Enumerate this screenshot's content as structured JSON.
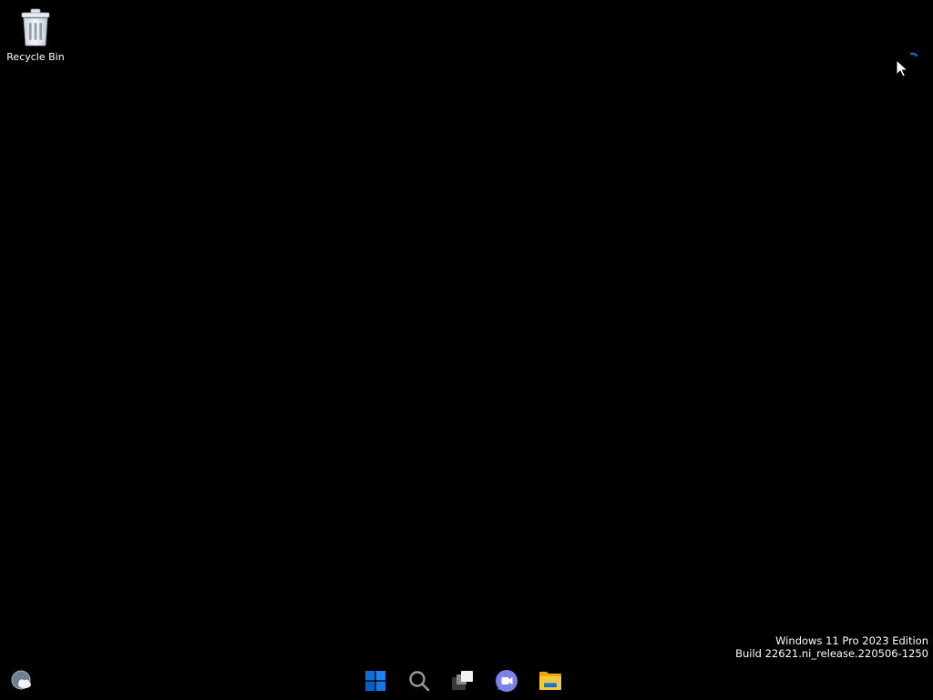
{
  "desktop": {
    "background_color": "#000000",
    "icons": [
      {
        "label": "Recycle Bin",
        "icon": "recycle-bin-icon"
      }
    ]
  },
  "watermark": {
    "line1": "Windows 11 Pro 2023 Edition",
    "line2": "Build 22621.ni_release.220506-1250"
  },
  "taskbar": {
    "left": {
      "icon": "weather-widget-icon"
    },
    "pinned": [
      {
        "name": "Start",
        "icon": "windows-start-icon",
        "color": "#1a73e8"
      },
      {
        "name": "Search",
        "icon": "search-icon",
        "color": "#9a9a9a"
      },
      {
        "name": "Task View",
        "icon": "task-view-icon",
        "color": "#ffffff"
      },
      {
        "name": "Chat",
        "icon": "teams-chat-icon",
        "color": "#7b83eb"
      },
      {
        "name": "File Explorer",
        "icon": "file-explorer-icon",
        "color": "#f4c542"
      }
    ]
  },
  "colors": {
    "accent": "#0078d4",
    "text": "#ffffff"
  }
}
